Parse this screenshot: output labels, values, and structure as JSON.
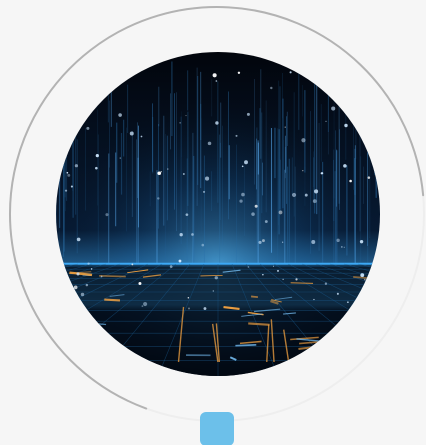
{
  "scene": {
    "image_subject": "digital-rain-grid",
    "colors": {
      "page_background": "#f6f6f6",
      "ring_stroke": "#b3b3b3",
      "sky_top": "#02050c",
      "horizon_glow": "#3da9f5",
      "floor_dark": "#02060d",
      "grid_line": "#1a5a8c",
      "warm_streak": "#f0a040",
      "cool_particle": "#cfe8ff",
      "handle": "#6cc0ea"
    }
  },
  "progress_ring": {
    "fill_fraction": 0.68
  },
  "handle": {
    "icon": "drag-handle"
  }
}
